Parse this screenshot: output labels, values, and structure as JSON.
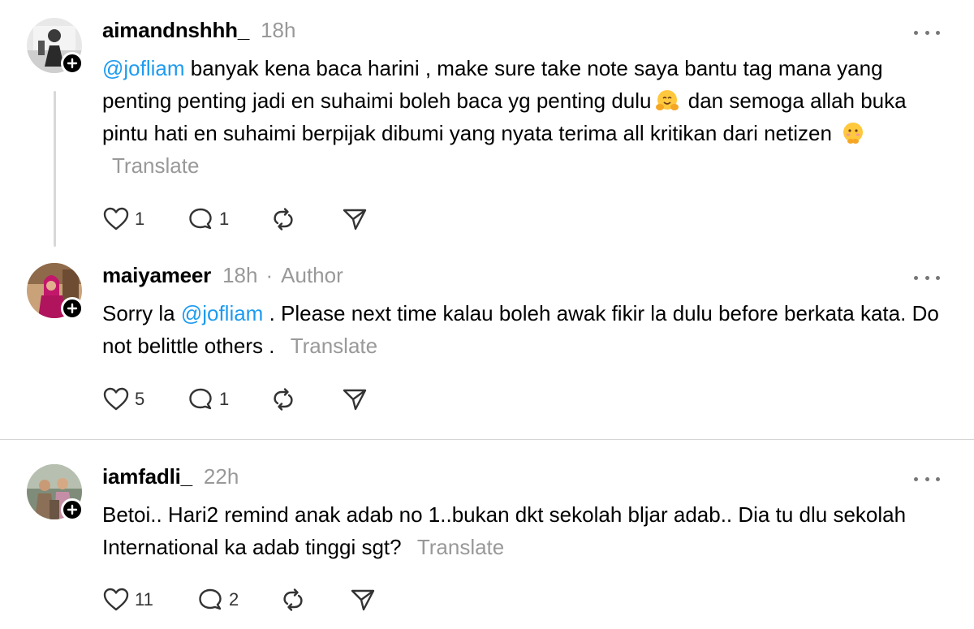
{
  "posts": [
    {
      "username": "aimandnshhh_",
      "time": "18h",
      "author_tag": "",
      "mention": "@jofliam",
      "text_1": " banyak kena baca harini , make sure take note saya bantu tag mana yang penting penting jadi en suhaimi boleh baca yg penting dulu",
      "text_2": " dan semoga allah buka pintu hati en suhaimi berpijak dibumi yang nyata terima all kritikan dari netizen ",
      "translate": "Translate",
      "likes": "1",
      "replies": "1",
      "reposts": "",
      "emojis": [
        "hugging-face-emoji",
        "shy-face-emoji"
      ]
    },
    {
      "username": "maiyameer",
      "time": "18h",
      "separator": "·",
      "author_tag": "Author",
      "text_pre": "Sorry la ",
      "mention": "@jofliam",
      "text_post": " . Please next time kalau boleh awak fikir la dulu before berkata kata. Do not belittle others . ",
      "translate": "Translate",
      "likes": "5",
      "replies": "1"
    },
    {
      "username": "iamfadli_",
      "time": "22h",
      "text": "Betoi.. Hari2 remind anak adab no 1..bukan dkt sekolah bljar adab.. Dia tu dlu sekolah International ka adab tinggi sgt? ",
      "translate": "Translate",
      "likes": "11",
      "replies": "2"
    }
  ],
  "colors": {
    "mention": "#1d9bf0",
    "muted": "#999999",
    "thread_line": "#d8d8d8",
    "divider": "#d5d5d5"
  },
  "icons": [
    "heart-icon",
    "comment-icon",
    "repost-icon",
    "share-icon",
    "more-icon",
    "follow-plus-icon"
  ]
}
